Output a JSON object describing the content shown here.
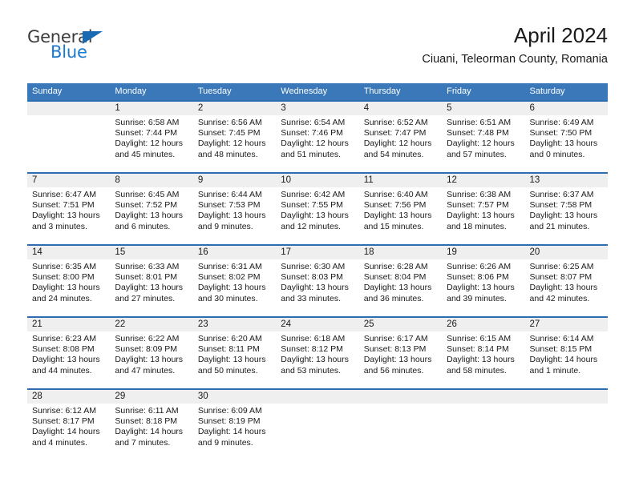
{
  "brand": {
    "name_part1": "General",
    "name_part2": "Blue",
    "accent_color": "#1a7ad1",
    "triangle_color": "#1a6ab3"
  },
  "header": {
    "title": "April 2024",
    "subtitle": "Ciuani, Teleorman County, Romania"
  },
  "colors": {
    "header_bar": "#3a78b9",
    "week_divider": "#2f6cb0",
    "day_band": "#efefef"
  },
  "weekdays": [
    "Sunday",
    "Monday",
    "Tuesday",
    "Wednesday",
    "Thursday",
    "Friday",
    "Saturday"
  ],
  "weeks": [
    {
      "days": [
        {
          "num": "",
          "sunrise": "",
          "sunset": "",
          "daylight1": "",
          "daylight2": ""
        },
        {
          "num": "1",
          "sunrise": "Sunrise: 6:58 AM",
          "sunset": "Sunset: 7:44 PM",
          "daylight1": "Daylight: 12 hours",
          "daylight2": "and 45 minutes."
        },
        {
          "num": "2",
          "sunrise": "Sunrise: 6:56 AM",
          "sunset": "Sunset: 7:45 PM",
          "daylight1": "Daylight: 12 hours",
          "daylight2": "and 48 minutes."
        },
        {
          "num": "3",
          "sunrise": "Sunrise: 6:54 AM",
          "sunset": "Sunset: 7:46 PM",
          "daylight1": "Daylight: 12 hours",
          "daylight2": "and 51 minutes."
        },
        {
          "num": "4",
          "sunrise": "Sunrise: 6:52 AM",
          "sunset": "Sunset: 7:47 PM",
          "daylight1": "Daylight: 12 hours",
          "daylight2": "and 54 minutes."
        },
        {
          "num": "5",
          "sunrise": "Sunrise: 6:51 AM",
          "sunset": "Sunset: 7:48 PM",
          "daylight1": "Daylight: 12 hours",
          "daylight2": "and 57 minutes."
        },
        {
          "num": "6",
          "sunrise": "Sunrise: 6:49 AM",
          "sunset": "Sunset: 7:50 PM",
          "daylight1": "Daylight: 13 hours",
          "daylight2": "and 0 minutes."
        }
      ]
    },
    {
      "days": [
        {
          "num": "7",
          "sunrise": "Sunrise: 6:47 AM",
          "sunset": "Sunset: 7:51 PM",
          "daylight1": "Daylight: 13 hours",
          "daylight2": "and 3 minutes."
        },
        {
          "num": "8",
          "sunrise": "Sunrise: 6:45 AM",
          "sunset": "Sunset: 7:52 PM",
          "daylight1": "Daylight: 13 hours",
          "daylight2": "and 6 minutes."
        },
        {
          "num": "9",
          "sunrise": "Sunrise: 6:44 AM",
          "sunset": "Sunset: 7:53 PM",
          "daylight1": "Daylight: 13 hours",
          "daylight2": "and 9 minutes."
        },
        {
          "num": "10",
          "sunrise": "Sunrise: 6:42 AM",
          "sunset": "Sunset: 7:55 PM",
          "daylight1": "Daylight: 13 hours",
          "daylight2": "and 12 minutes."
        },
        {
          "num": "11",
          "sunrise": "Sunrise: 6:40 AM",
          "sunset": "Sunset: 7:56 PM",
          "daylight1": "Daylight: 13 hours",
          "daylight2": "and 15 minutes."
        },
        {
          "num": "12",
          "sunrise": "Sunrise: 6:38 AM",
          "sunset": "Sunset: 7:57 PM",
          "daylight1": "Daylight: 13 hours",
          "daylight2": "and 18 minutes."
        },
        {
          "num": "13",
          "sunrise": "Sunrise: 6:37 AM",
          "sunset": "Sunset: 7:58 PM",
          "daylight1": "Daylight: 13 hours",
          "daylight2": "and 21 minutes."
        }
      ]
    },
    {
      "days": [
        {
          "num": "14",
          "sunrise": "Sunrise: 6:35 AM",
          "sunset": "Sunset: 8:00 PM",
          "daylight1": "Daylight: 13 hours",
          "daylight2": "and 24 minutes."
        },
        {
          "num": "15",
          "sunrise": "Sunrise: 6:33 AM",
          "sunset": "Sunset: 8:01 PM",
          "daylight1": "Daylight: 13 hours",
          "daylight2": "and 27 minutes."
        },
        {
          "num": "16",
          "sunrise": "Sunrise: 6:31 AM",
          "sunset": "Sunset: 8:02 PM",
          "daylight1": "Daylight: 13 hours",
          "daylight2": "and 30 minutes."
        },
        {
          "num": "17",
          "sunrise": "Sunrise: 6:30 AM",
          "sunset": "Sunset: 8:03 PM",
          "daylight1": "Daylight: 13 hours",
          "daylight2": "and 33 minutes."
        },
        {
          "num": "18",
          "sunrise": "Sunrise: 6:28 AM",
          "sunset": "Sunset: 8:04 PM",
          "daylight1": "Daylight: 13 hours",
          "daylight2": "and 36 minutes."
        },
        {
          "num": "19",
          "sunrise": "Sunrise: 6:26 AM",
          "sunset": "Sunset: 8:06 PM",
          "daylight1": "Daylight: 13 hours",
          "daylight2": "and 39 minutes."
        },
        {
          "num": "20",
          "sunrise": "Sunrise: 6:25 AM",
          "sunset": "Sunset: 8:07 PM",
          "daylight1": "Daylight: 13 hours",
          "daylight2": "and 42 minutes."
        }
      ]
    },
    {
      "days": [
        {
          "num": "21",
          "sunrise": "Sunrise: 6:23 AM",
          "sunset": "Sunset: 8:08 PM",
          "daylight1": "Daylight: 13 hours",
          "daylight2": "and 44 minutes."
        },
        {
          "num": "22",
          "sunrise": "Sunrise: 6:22 AM",
          "sunset": "Sunset: 8:09 PM",
          "daylight1": "Daylight: 13 hours",
          "daylight2": "and 47 minutes."
        },
        {
          "num": "23",
          "sunrise": "Sunrise: 6:20 AM",
          "sunset": "Sunset: 8:11 PM",
          "daylight1": "Daylight: 13 hours",
          "daylight2": "and 50 minutes."
        },
        {
          "num": "24",
          "sunrise": "Sunrise: 6:18 AM",
          "sunset": "Sunset: 8:12 PM",
          "daylight1": "Daylight: 13 hours",
          "daylight2": "and 53 minutes."
        },
        {
          "num": "25",
          "sunrise": "Sunrise: 6:17 AM",
          "sunset": "Sunset: 8:13 PM",
          "daylight1": "Daylight: 13 hours",
          "daylight2": "and 56 minutes."
        },
        {
          "num": "26",
          "sunrise": "Sunrise: 6:15 AM",
          "sunset": "Sunset: 8:14 PM",
          "daylight1": "Daylight: 13 hours",
          "daylight2": "and 58 minutes."
        },
        {
          "num": "27",
          "sunrise": "Sunrise: 6:14 AM",
          "sunset": "Sunset: 8:15 PM",
          "daylight1": "Daylight: 14 hours",
          "daylight2": "and 1 minute."
        }
      ]
    },
    {
      "days": [
        {
          "num": "28",
          "sunrise": "Sunrise: 6:12 AM",
          "sunset": "Sunset: 8:17 PM",
          "daylight1": "Daylight: 14 hours",
          "daylight2": "and 4 minutes."
        },
        {
          "num": "29",
          "sunrise": "Sunrise: 6:11 AM",
          "sunset": "Sunset: 8:18 PM",
          "daylight1": "Daylight: 14 hours",
          "daylight2": "and 7 minutes."
        },
        {
          "num": "30",
          "sunrise": "Sunrise: 6:09 AM",
          "sunset": "Sunset: 8:19 PM",
          "daylight1": "Daylight: 14 hours",
          "daylight2": "and 9 minutes."
        },
        {
          "num": "",
          "sunrise": "",
          "sunset": "",
          "daylight1": "",
          "daylight2": ""
        },
        {
          "num": "",
          "sunrise": "",
          "sunset": "",
          "daylight1": "",
          "daylight2": ""
        },
        {
          "num": "",
          "sunrise": "",
          "sunset": "",
          "daylight1": "",
          "daylight2": ""
        },
        {
          "num": "",
          "sunrise": "",
          "sunset": "",
          "daylight1": "",
          "daylight2": ""
        }
      ]
    }
  ]
}
